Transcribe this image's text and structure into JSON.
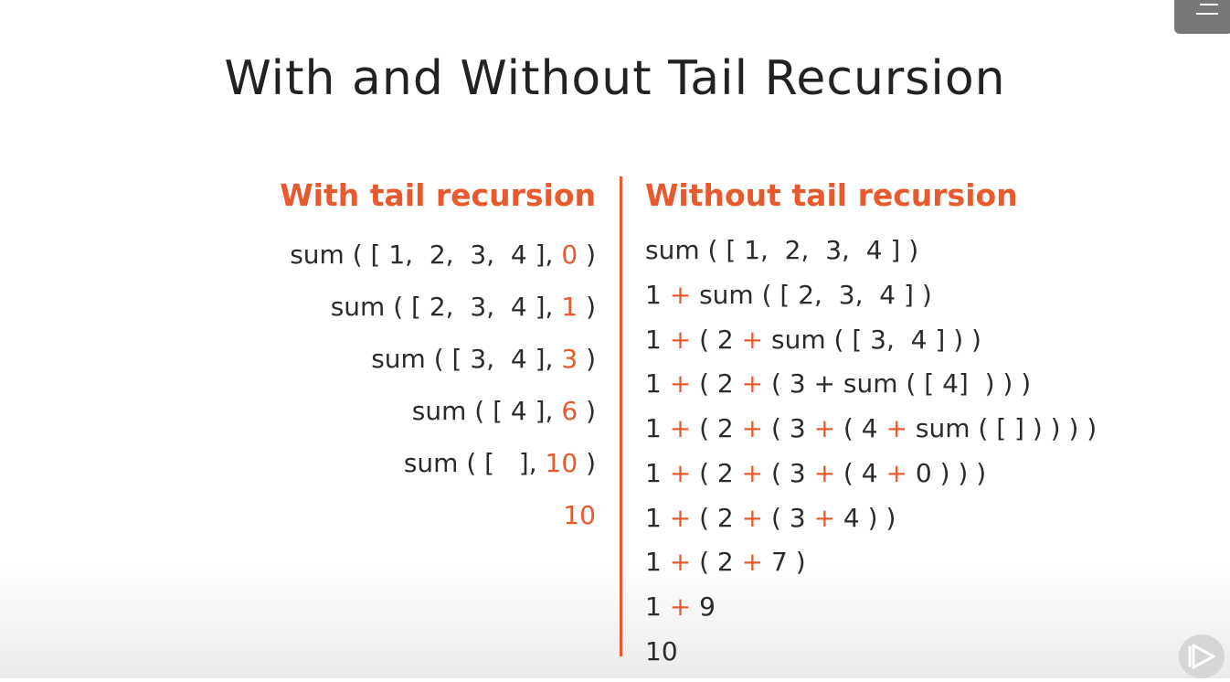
{
  "slide": {
    "title": "With and Without Tail Recursion"
  },
  "with_tail": {
    "heading": "With tail recursion",
    "lines": [
      {
        "text": "sum ( [ 1,  2,  3,  4 ], ",
        "accumulator": "0",
        "close": " )"
      },
      {
        "text": "sum ( [ 2,  3,  4 ], ",
        "accumulator": "1",
        "close": " )"
      },
      {
        "text": "sum ( [ 3,  4 ], ",
        "accumulator": "3",
        "close": " )"
      },
      {
        "text": "sum ( [ 4 ], ",
        "accumulator": "6",
        "close": " )"
      },
      {
        "text": "sum ( [   ], ",
        "accumulator": "10",
        "close": " )"
      },
      {
        "text": "",
        "accumulator": "10",
        "close": ""
      }
    ]
  },
  "without_tail": {
    "heading": "Without tail recursion",
    "plus": "+",
    "lines": [
      [
        "sum ( [ 1,  2,  3,  4 ] )"
      ],
      [
        "1 ",
        " sum ( [ 2,  3,  4 ] )"
      ],
      [
        "1 ",
        " ( 2 ",
        " sum ( [ 3,  4 ] ) )"
      ],
      [
        "1 ",
        " ( 2 ",
        " ( 3 + sum ( [ 4]  ) ) )"
      ],
      [
        "1 ",
        " ( 2 ",
        " ( 3 ",
        " ( 4 ",
        " sum ( [ ] ) ) ) )"
      ],
      [
        "1 ",
        " ( 2 ",
        " ( 3 ",
        " ( 4 ",
        " 0 ) ) )"
      ],
      [
        "1 ",
        " ( 2 ",
        " ( 3 ",
        " 4 ) )"
      ],
      [
        "1 ",
        " ( 2 ",
        " 7 )"
      ],
      [
        "1 ",
        " 9"
      ],
      [
        "10"
      ]
    ]
  },
  "colors": {
    "accent": "#e85a2e",
    "text": "#2b2b2b",
    "title": "#222222"
  },
  "icons": {
    "menu": "menu-icon",
    "play": "play-icon"
  }
}
